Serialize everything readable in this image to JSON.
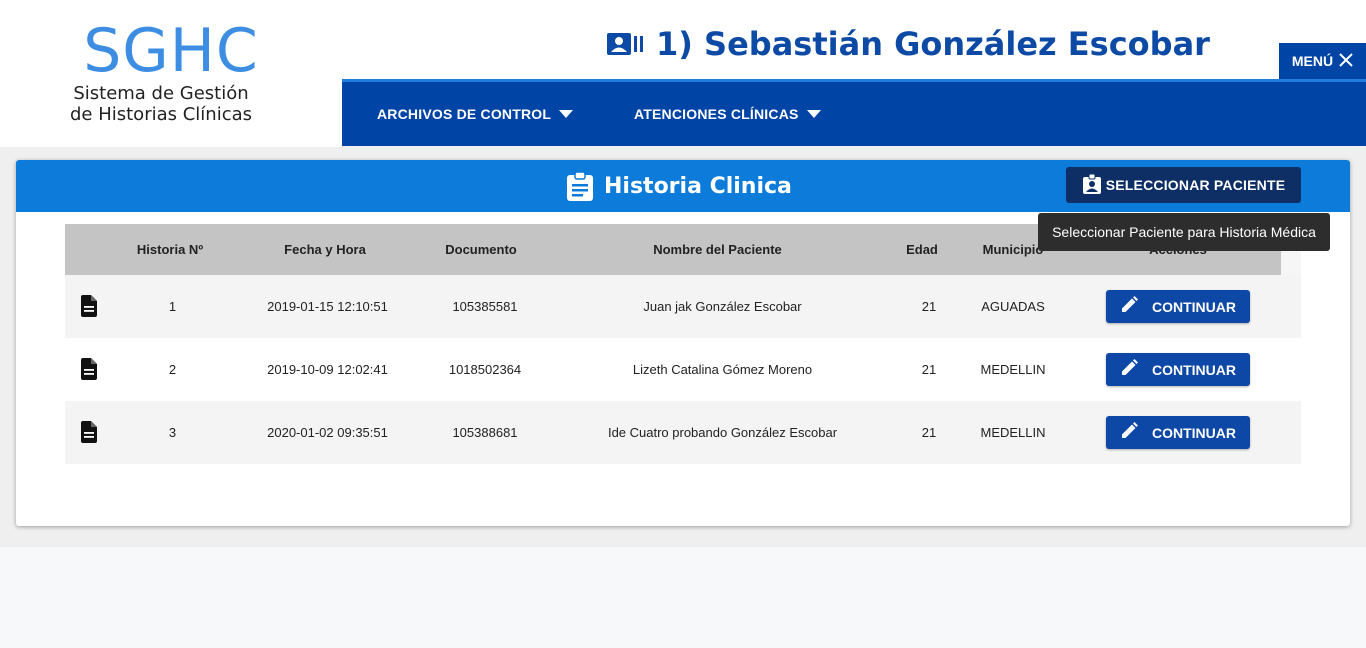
{
  "logo": {
    "title": "SGHC",
    "subtitle_line1": "Sistema de Gestión",
    "subtitle_line2": "de Historias Clínicas"
  },
  "patient_header": {
    "title": "1) Sebastián González Escobar",
    "icon": "id-card-icon"
  },
  "nav": {
    "items": [
      {
        "label": "ARCHIVOS DE CONTROL"
      },
      {
        "label": "ATENCIONES CLÍNICAS"
      }
    ],
    "menu_label": "MENÚ"
  },
  "card": {
    "title": "Historia Clinica",
    "select_button": "SELECCIONAR PACIENTE",
    "tooltip": "Seleccionar Paciente para Historia Médica"
  },
  "table": {
    "headers": {
      "historia": "Historia Nº",
      "fecha": "Fecha y Hora",
      "documento": "Documento",
      "nombre": "Nombre del Paciente",
      "edad": "Edad",
      "municipio": "Municipio",
      "acciones": "Acciones"
    },
    "rows": [
      {
        "historia": "1",
        "fecha": "2019-01-15 12:10:51",
        "documento": "105385581",
        "nombre": "Juan jak González Escobar",
        "edad": "21",
        "municipio": "AGUADAS",
        "action": "CONTINUAR"
      },
      {
        "historia": "2",
        "fecha": "2019-10-09 12:02:41",
        "documento": "1018502364",
        "nombre": "Lizeth Catalina Gómez Moreno",
        "edad": "21",
        "municipio": "MEDELLIN",
        "action": "CONTINUAR"
      },
      {
        "historia": "3",
        "fecha": "2020-01-02 09:35:51",
        "documento": "105388681",
        "nombre": "Ide Cuatro probando González Escobar",
        "edad": "21",
        "municipio": "MEDELLIN",
        "action": "CONTINUAR"
      }
    ]
  },
  "colors": {
    "brand_blue": "#0045a6",
    "logo_blue": "#3d8ee3",
    "header_blue": "#0c7bd9",
    "button_dark": "#0d2f66"
  }
}
